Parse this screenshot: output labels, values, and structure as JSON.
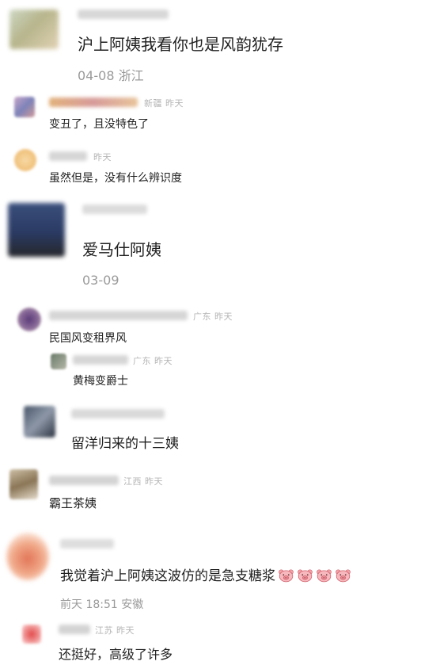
{
  "comments": [
    {
      "text": "沪上阿姨我看你也是风韵犹存",
      "date": "04-08",
      "location": "浙江"
    },
    {
      "text": "变丑了，且没特色了",
      "location": "新疆",
      "time": "昨天"
    },
    {
      "text": "虽然但是，没有什么辨识度",
      "time": "昨天"
    },
    {
      "text": "爱马仕阿姨",
      "date": "03-09"
    },
    {
      "text": "民国风变租界风",
      "location": "广东",
      "time": "昨天"
    },
    {
      "text": "黄梅变爵士",
      "location": "广东",
      "time": "昨天"
    },
    {
      "text": "留洋归来的十三姨"
    },
    {
      "text": "霸王茶姨",
      "location": "江西",
      "time": "昨天"
    },
    {
      "text": "我觉着沪上阿姨这波仿的是急支糖浆",
      "emoji": "pig-face-icon",
      "emoji_count": 4,
      "date": "前天 18:51",
      "location": "安徽"
    },
    {
      "text": "还挺好，高级了许多",
      "location": "江苏",
      "time": "昨天"
    }
  ]
}
